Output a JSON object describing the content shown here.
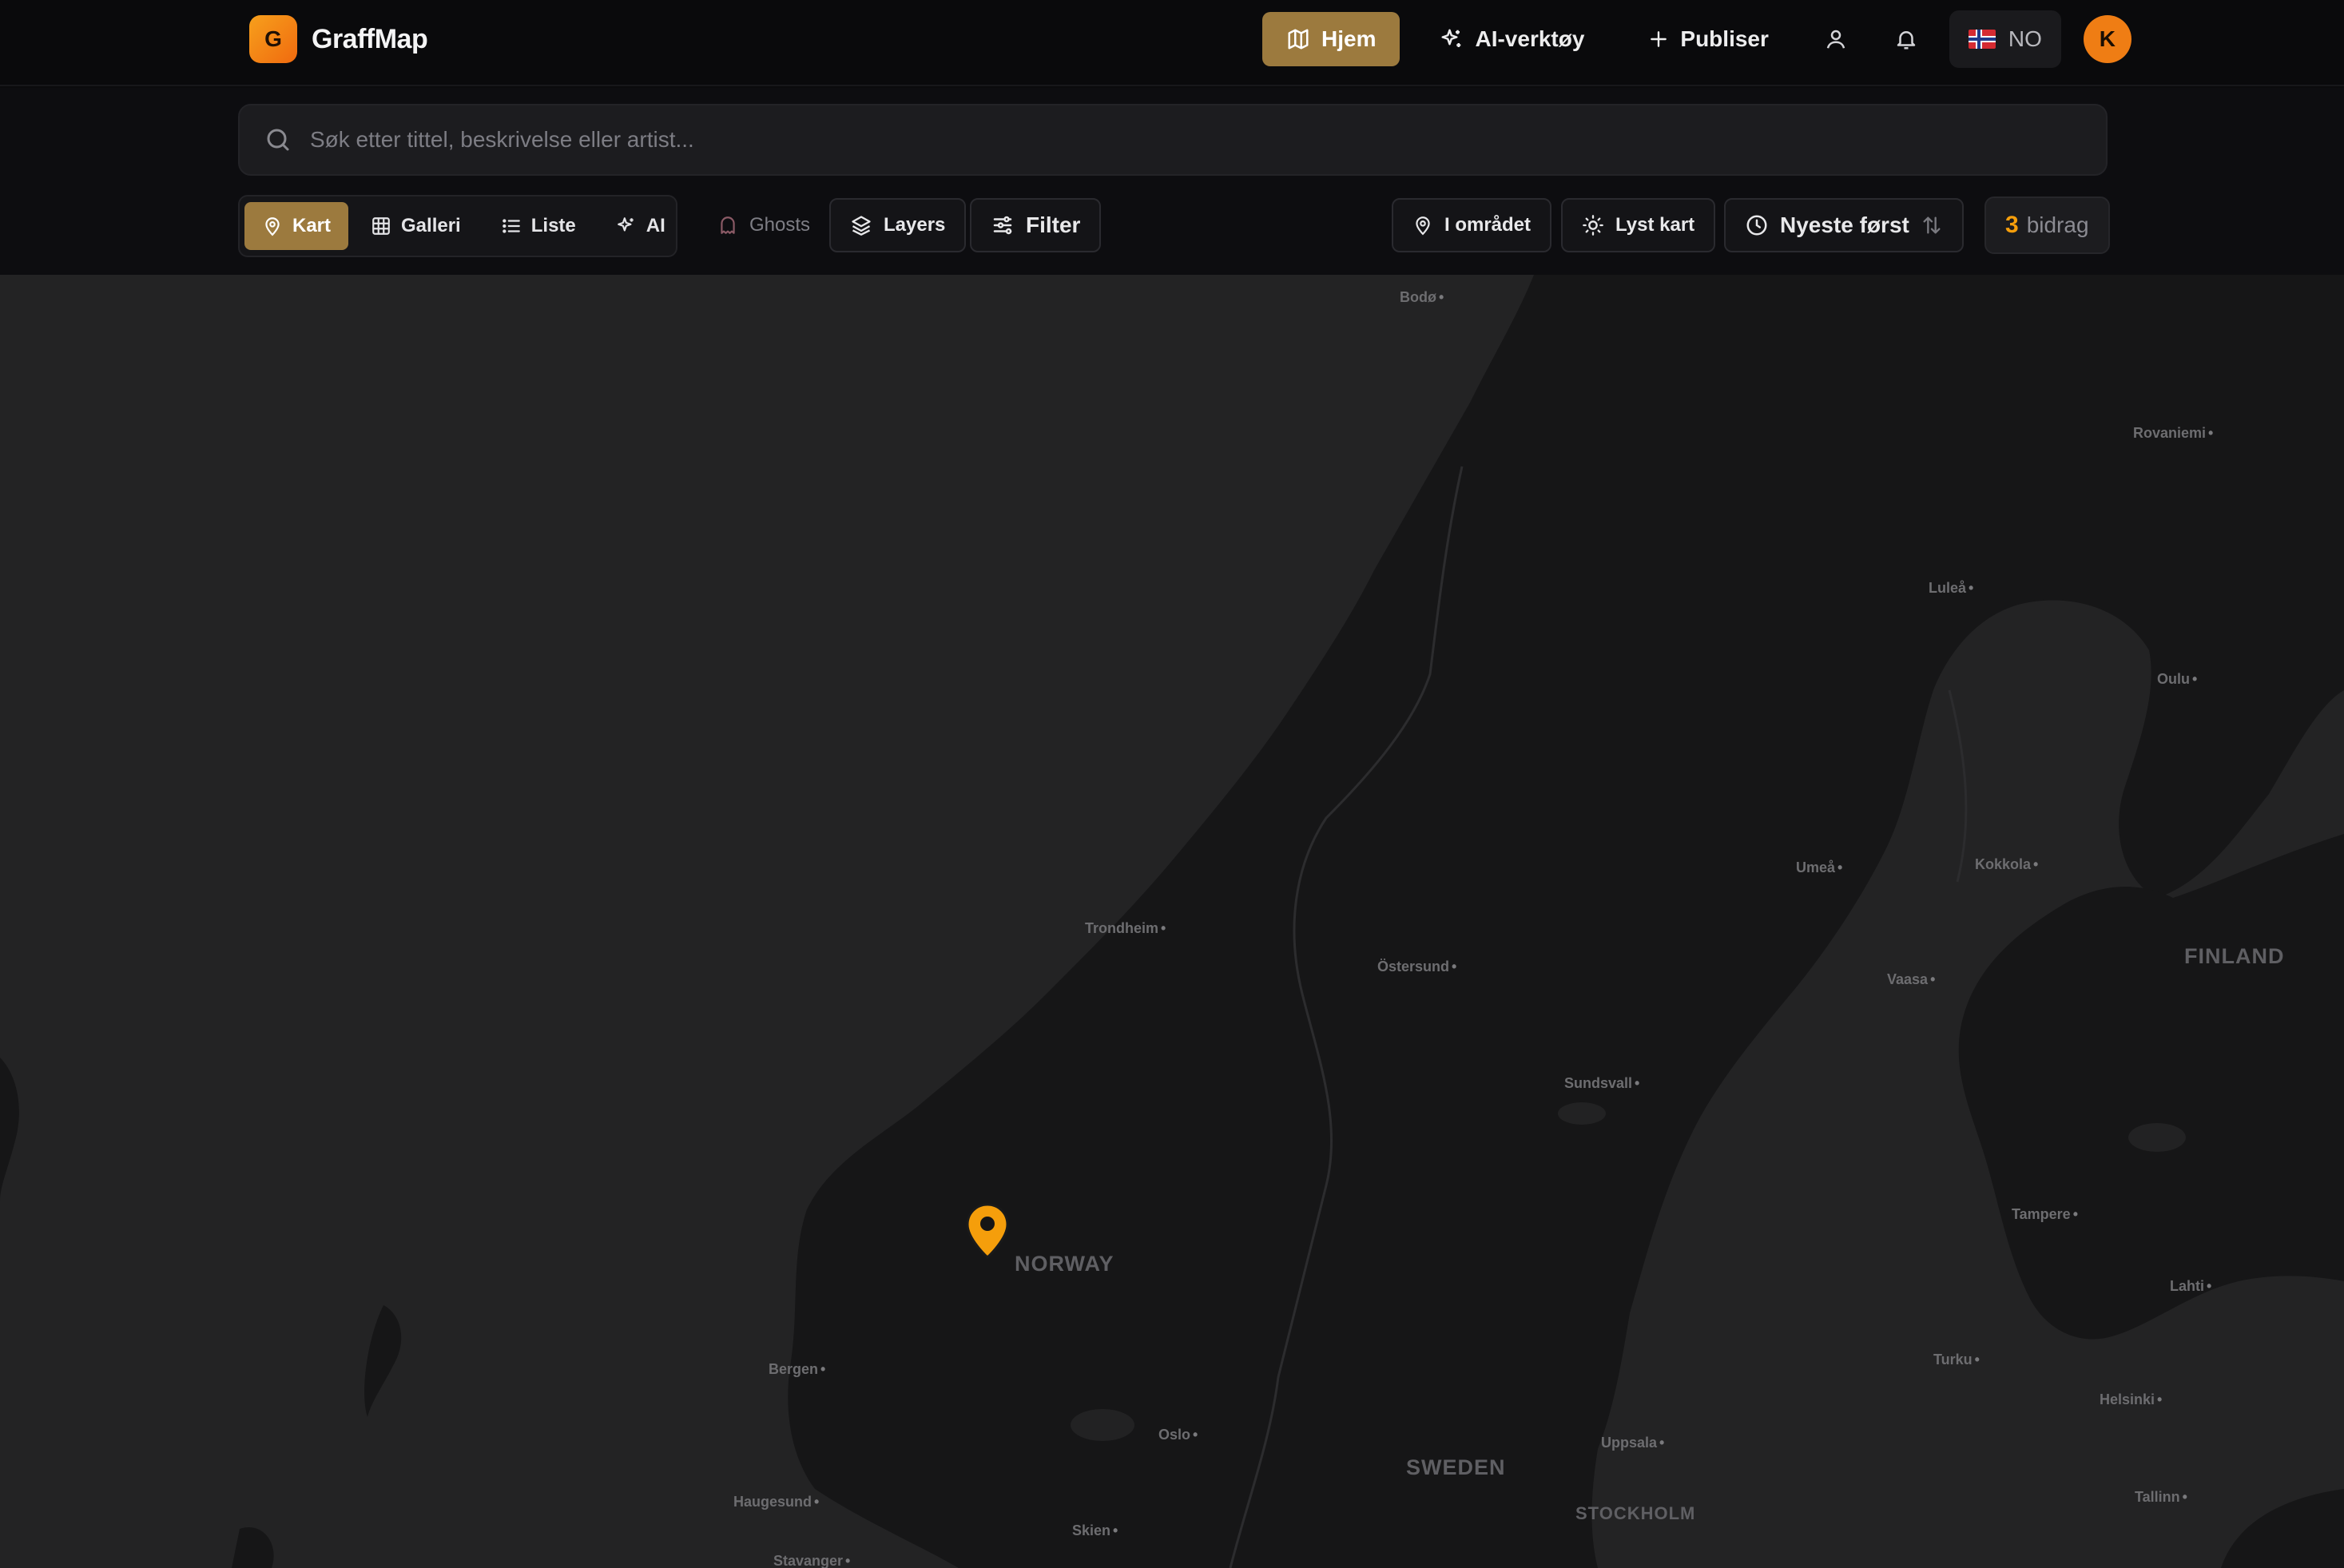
{
  "app": {
    "logo_letter": "G",
    "name": "GraffMap"
  },
  "nav": {
    "home": "Hjem",
    "ai_tools": "AI-verktøy",
    "publish": "Publiser",
    "language": "NO",
    "avatar_initial": "K"
  },
  "search": {
    "placeholder": "Søk etter tittel, beskrivelse eller artist...",
    "value": ""
  },
  "views": {
    "map": "Kart",
    "gallery": "Galleri",
    "list": "Liste",
    "ai": "AI",
    "active": "map"
  },
  "toolbar": {
    "ghosts": "Ghosts",
    "layers": "Layers",
    "filter": "Filter",
    "in_area": "I området",
    "light_map": "Lyst kart",
    "sort": "Nyeste først",
    "count": "3",
    "count_label": "bidrag"
  },
  "map": {
    "countries": [
      "NORWAY",
      "SWEDEN",
      "FINLAND"
    ],
    "cities": [
      "Bodø",
      "Rovaniemi",
      "Luleå",
      "Oulu",
      "Umeå",
      "Kokkola",
      "Trondheim",
      "Östersund",
      "Vaasa",
      "Sundsvall",
      "Tampere",
      "Lahti",
      "Bergen",
      "Oslo",
      "Uppsala",
      "Turku",
      "Helsinki",
      "Haugesund",
      "Skien",
      "Stavanger",
      "Tallinn",
      "STOCKHOLM"
    ],
    "marker_color": "#f59e0b"
  },
  "colors": {
    "accent": "#9c7a3e",
    "brand": "#f28a13",
    "land": "#161617",
    "water": "#232324"
  }
}
